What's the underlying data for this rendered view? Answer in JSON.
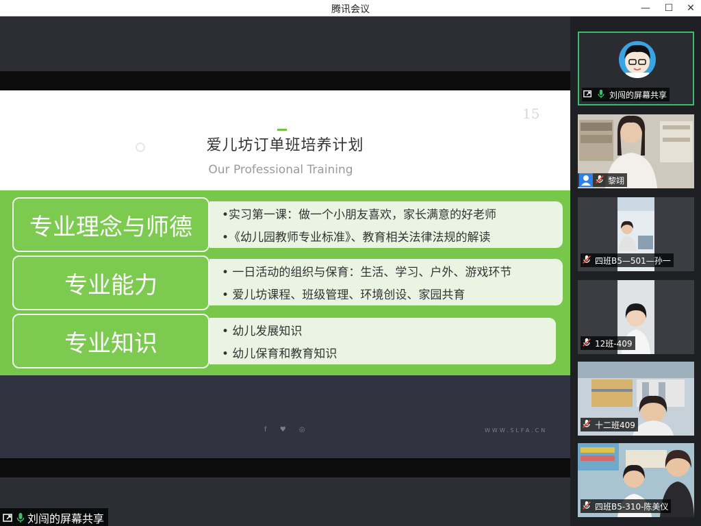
{
  "app": {
    "title": "腾讯会议"
  },
  "window_controls": {
    "minimize": "—",
    "maximize": "☐",
    "close": "✕"
  },
  "slide": {
    "page_number": "15",
    "title": "爱儿坊订单班培养计划",
    "subtitle": "Our Professional Training",
    "sections": [
      {
        "label": "专业理念与师德",
        "lines": [
          "•实习第一课：做一个小朋友喜欢，家长满意的好老师",
          "•《幼儿园教师专业标准》、教育相关法律法规的解读"
        ]
      },
      {
        "label": "专业能力",
        "lines": [
          "• 一日活动的组织与保育：生活、学习、户外、游戏环节",
          "• 爱儿坊课程、班级管理、环境创设、家园共育"
        ]
      },
      {
        "label": "专业知识",
        "lines": [
          "• 幼儿发展知识",
          "• 幼儿保育和教育知识"
        ]
      }
    ],
    "footer_social": "f ♥ ◎",
    "footer_url": "WWW.SLFA.CN"
  },
  "sharer_label": "刘闯的屏幕共享",
  "participants": [
    {
      "name": "刘闯的屏幕共享",
      "active": true
    },
    {
      "name": "黎翊",
      "active": false
    },
    {
      "name": "四班B5—501—孙一",
      "active": false
    },
    {
      "name": "12班-409",
      "active": false
    },
    {
      "name": "十二班409",
      "active": false
    },
    {
      "name": "四班B5-310-陈美仪",
      "active": false
    }
  ],
  "colors": {
    "accent_green": "#77c74a",
    "active_border": "#3bbf6a",
    "mic_muted": "#e74c3c",
    "mic_on": "#3bbf6a"
  }
}
